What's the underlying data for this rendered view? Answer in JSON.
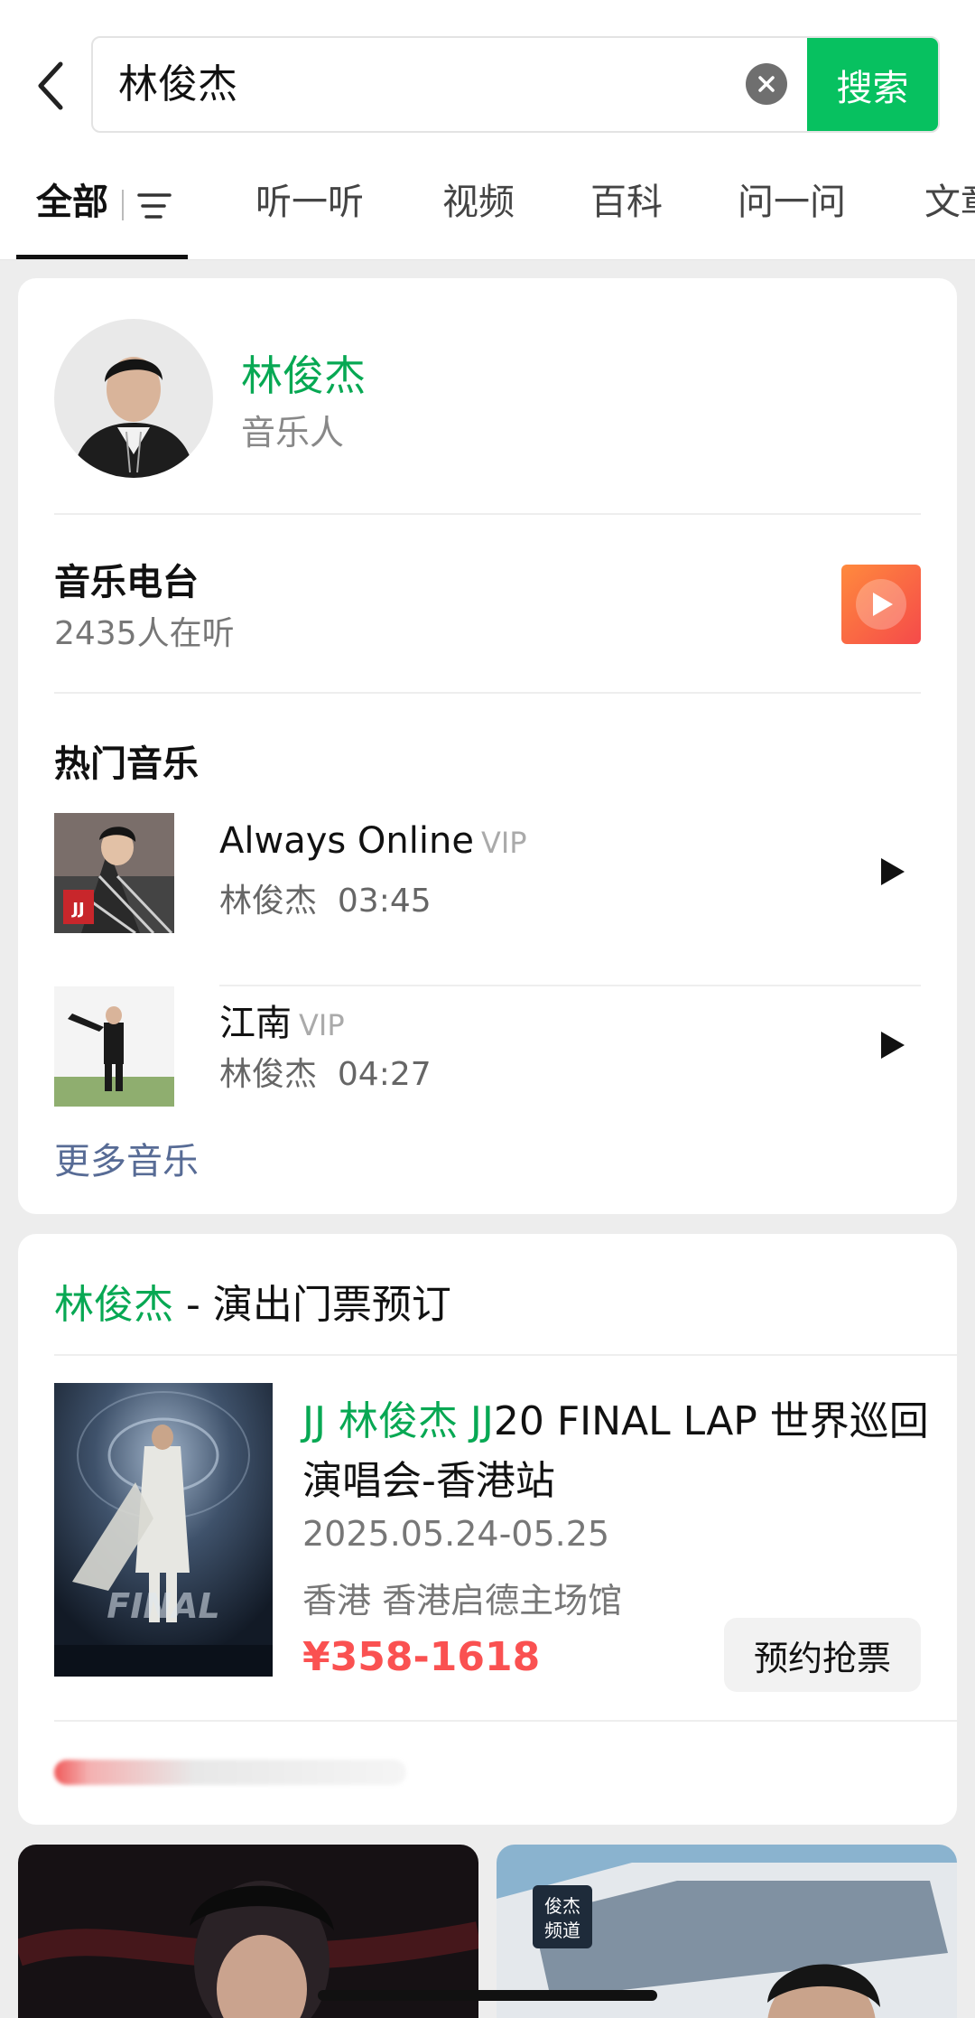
{
  "search": {
    "query": "林俊杰",
    "button_label": "搜索"
  },
  "tabs": [
    {
      "label": "全部",
      "active": true
    },
    {
      "label": "听一听",
      "active": false
    },
    {
      "label": "视频",
      "active": false
    },
    {
      "label": "百科",
      "active": false
    },
    {
      "label": "问一问",
      "active": false
    },
    {
      "label": "文章",
      "active": false
    }
  ],
  "profile": {
    "name": "林俊杰",
    "role": "音乐人"
  },
  "radio": {
    "title": "音乐电台",
    "listeners": "2435人在听"
  },
  "hot_music": {
    "heading": "热门音乐",
    "songs": [
      {
        "title": "Always Online",
        "badge": "VIP",
        "artist": "林俊杰",
        "duration": "03:45"
      },
      {
        "title": "江南",
        "badge": "VIP",
        "artist": "林俊杰",
        "duration": "04:27"
      }
    ],
    "more_label": "更多音乐"
  },
  "tickets": {
    "heading_highlight": "林俊杰",
    "heading_rest": " - 演出门票预订",
    "show": {
      "title_highlight": "JJ 林俊杰 JJ",
      "title_rest": "20 FINAL LAP 世界巡回演唱会-香港站",
      "date": "2025.05.24-05.25",
      "venue": "香港 香港启德主场馆",
      "price": "¥358-1618",
      "button_label": "预约抢票"
    }
  },
  "colors": {
    "accent_green": "#07c160",
    "link_blue": "#576b95",
    "price_red": "#fa5151"
  }
}
